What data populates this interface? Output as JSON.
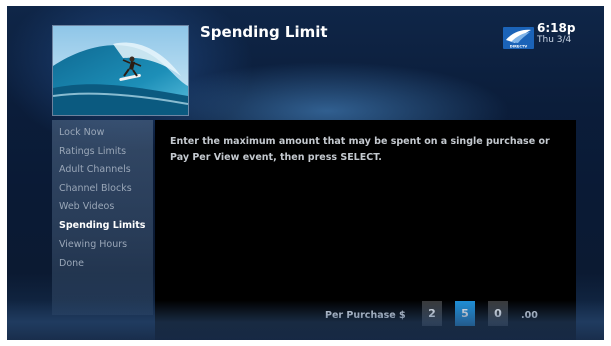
{
  "header": {
    "title": "Spending Limit",
    "time": "6:18p",
    "date": "Thu 3/4",
    "logo_text": "DIRECTV",
    "logo_icon": "directv-logo-icon",
    "thumbnail_icon": "surfer-thumbnail"
  },
  "menu": {
    "items": [
      {
        "label": "Lock Now"
      },
      {
        "label": "Ratings Limits"
      },
      {
        "label": "Adult Channels"
      },
      {
        "label": "Channel Blocks"
      },
      {
        "label": "Web Videos"
      },
      {
        "label": "Spending Limits",
        "selected": true
      },
      {
        "label": "Viewing Hours"
      },
      {
        "label": "Done"
      }
    ]
  },
  "panel": {
    "instructions": "Enter the maximum amount that may be spent on a single purchase or Pay Per View event, then press SELECT.",
    "per_purchase_label": "Per Purchase $",
    "digits": [
      "2",
      "5",
      "0"
    ],
    "active_digit_index": 1,
    "decimals": ".00"
  },
  "colors": {
    "active_digit": "#1e90d8",
    "digit_box": "#3a3a3a",
    "menu_selected": "#ffffff",
    "menu_normal": "#9aa7b8"
  }
}
